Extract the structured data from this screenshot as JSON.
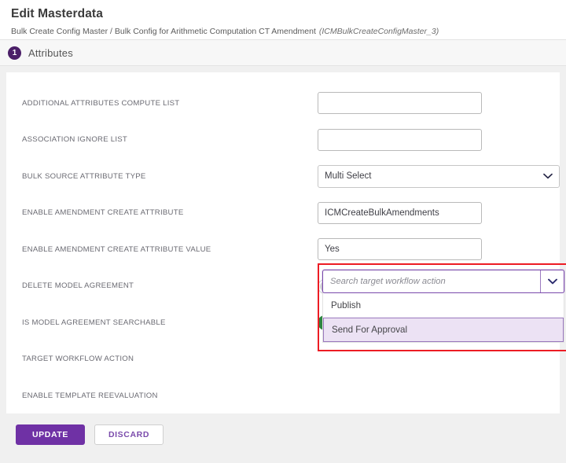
{
  "header": {
    "title": "Edit Masterdata",
    "breadcrumb": "Bulk Create Config Master / Bulk Config for Arithmetic Computation CT Amendment",
    "breadcrumb_id": "(ICMBulkCreateConfigMaster_3)"
  },
  "section": {
    "step_number": "1",
    "title": "Attributes"
  },
  "fields": [
    {
      "label": "ADDITIONAL ATTRIBUTES COMPUTE LIST",
      "type": "text",
      "value": "",
      "placeholder": ""
    },
    {
      "label": "ASSOCIATION IGNORE LIST",
      "type": "text",
      "value": "",
      "placeholder": ""
    },
    {
      "label": "BULK SOURCE ATTRIBUTE TYPE",
      "type": "select",
      "value": "Multi Select"
    },
    {
      "label": "ENABLE AMENDMENT CREATE ATTRIBUTE",
      "type": "text",
      "value": "ICMCreateBulkAmendments",
      "placeholder": ""
    },
    {
      "label": "ENABLE AMENDMENT CREATE ATTRIBUTE VALUE",
      "type": "text",
      "value": "Yes",
      "placeholder": ""
    },
    {
      "label": "DELETE MODEL AGREEMENT",
      "type": "toggle",
      "value": "No",
      "state": "off"
    },
    {
      "label": "IS MODEL AGREEMENT SEARCHABLE",
      "type": "toggle",
      "value": "Yes",
      "state": "on"
    },
    {
      "label": "TARGET WORKFLOW ACTION",
      "type": "combo",
      "value": ""
    },
    {
      "label": "ENABLE TEMPLATE REEVALUATION",
      "type": "empty",
      "value": ""
    }
  ],
  "combo": {
    "placeholder": "Search target workflow action",
    "options": [
      {
        "label": "Publish",
        "selected": false
      },
      {
        "label": "Send For Approval",
        "selected": true
      }
    ]
  },
  "footer": {
    "update_label": "UPDATE",
    "discard_label": "DISCARD"
  },
  "colors": {
    "brand_purple": "#6f31a5",
    "step_badge": "#4b1f68",
    "toggle_on_green": "#2e8540",
    "highlight_red": "#ed1c24",
    "option_selected_bg": "#ece2f4"
  }
}
